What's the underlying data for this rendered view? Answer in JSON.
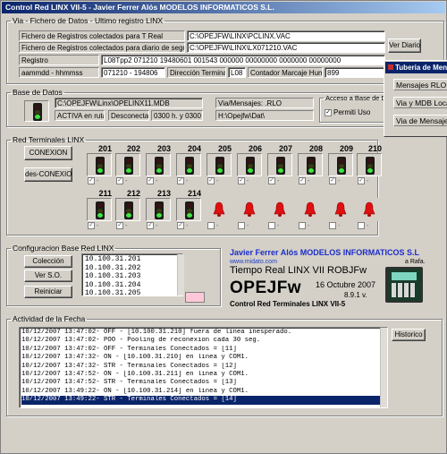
{
  "window": {
    "title": "Control Red LINX VII-5 - Javier Ferrer Alós MODELOS INFORMATICOS S.L."
  },
  "fichero": {
    "legend": "Via - Fichero de Datos - Ultimo registro LINX",
    "row1_label": "Fichero de Registros colectados para T Real",
    "row1_value": "C:\\OPEJFW\\LINX\\PCLINX.VAC",
    "row2_label": "Fichero de Registros colectados para diario de seguridad",
    "row2_value": "C:\\OPEJFW\\LINX\\LX071210.VAC",
    "ver_diario": "Ver Diario",
    "registro_label": "Registro",
    "registro_value": "L08Tpp2 071210 19480601 001543 000000 00000000 0000000 00000000",
    "fmt_label": "aammdd - hhmmss",
    "fmt_value": "071210 - 194806",
    "dir_label": "Dirección Terminal",
    "dir_value": "L08",
    "cont_label": "Contador Marcaje Humano",
    "cont_value": "899"
  },
  "menu": {
    "title": "Tuberia de Mensajes",
    "items": [
      "Mensajes RLO T.Real",
      "Via y MDB Locales",
      "Via de Mensajes LX"
    ]
  },
  "base": {
    "legend": "Base de Datos",
    "path": "C:\\OPEJFW\\Linx\\OPELINX11.MDB",
    "status1": "ACTIVA en ruta",
    "status2": "Desconecta",
    "status3": "0300 h. y 0300 h.",
    "via_label": "Via/Mensajes: .RLO",
    "via_value": "H:\\Opejfw\\Dat\\",
    "acceso_legend": "Acceso a Base de Datos",
    "permit_label": "Permiti Uso"
  },
  "terminales": {
    "legend": "Red Terminales LINX",
    "conexion_btn": "CONEXION",
    "desconexion_btn": "des-CONEXION",
    "row1": [
      "201",
      "202",
      "203",
      "204",
      "205",
      "206",
      "207",
      "208",
      "209",
      "210"
    ],
    "row2": [
      "211",
      "212",
      "213",
      "214",
      "",
      "",
      "",
      "",
      "",
      ""
    ]
  },
  "config": {
    "legend": "Configuracion Base Red LINX",
    "btn_coleccion": "Colección",
    "btn_vers": "Ver S.O.",
    "btn_reiniciar": "Reiniciar",
    "ips": [
      "10.100.31.201",
      "10.100.31.202",
      "10.100.31.203",
      "10.100.31.204",
      "10.100.31.205"
    ]
  },
  "branding": {
    "company": "Javier Ferrer Alós MODELOS INFORMATICOS S.L",
    "web": "www.midato.com",
    "rafa": "a Rafa.",
    "product": "Tiempo Real LINX VII ROBJFw",
    "logo": "OPEJFw",
    "date": "16 Octubre 2007",
    "version": "8.9.1 v.",
    "subtitle": "Control Red Terminales LINX VII-5"
  },
  "actividad": {
    "legend": "Actividad de la Fecha",
    "historico_btn": "Historico",
    "lines": [
      "10/12/2007 13:47:02- OFF - [10.100.31.210] fuera de linea inesperado.",
      "10/12/2007 13:47:02- POO - Pooling de reconexion cada 30 seg.",
      "10/12/2007 13:47:02- OFF - Terminales Conectados = [11]",
      "10/12/2007 13:47:32- ON  - [10.100.31.210] en linea y COM1.",
      "10/12/2007 13:47:32- STR - Terminales Conectados = [12]",
      "10/12/2007 13:47:52- ON  - [10.100.31.211] en linea y COM1.",
      "10/12/2007 13:47:52- STR - Terminales Conectados = [13]",
      "10/12/2007 13:49:22- ON  - [10.100.31.214] en linea y COM1.",
      "10/12/2007 13:49:22- STR - Terminales Conectados = [14]"
    ]
  }
}
